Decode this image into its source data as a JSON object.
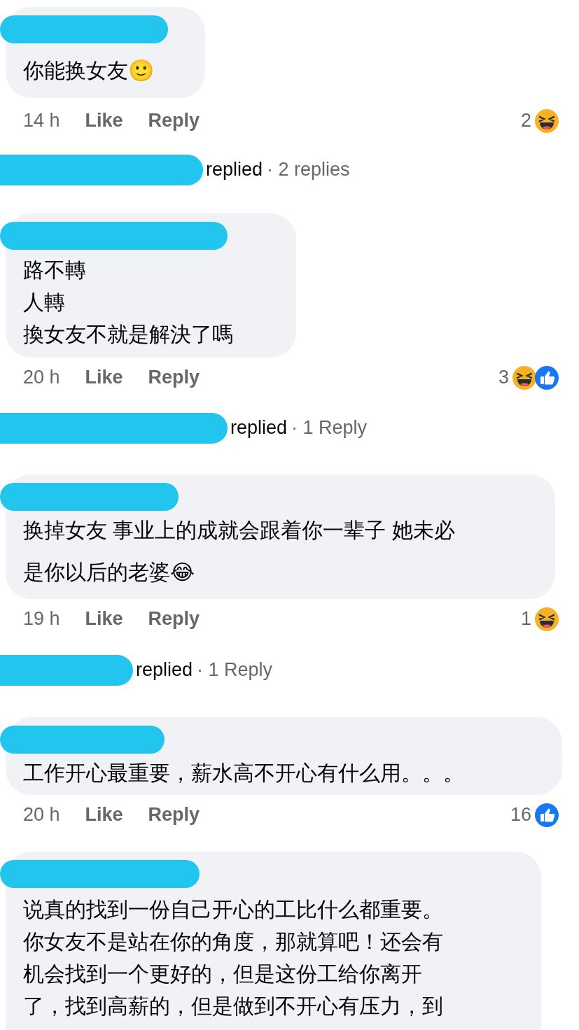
{
  "comments": [
    {
      "lines": [
        "你能换女友🙂"
      ],
      "time": "14 h",
      "actions": [
        "Like",
        "Reply"
      ],
      "reaction_count": "2",
      "reactions": [
        {
          "kind": "haha"
        }
      ],
      "replies": {
        "label": "replied",
        "count": "· 2 replies"
      }
    },
    {
      "lines": [
        "路不轉",
        "人轉",
        "換女友不就是解決了嗎"
      ],
      "time": "20 h",
      "actions": [
        "Like",
        "Reply"
      ],
      "reaction_count": "3",
      "reactions": [
        {
          "kind": "haha"
        },
        {
          "kind": "like"
        }
      ],
      "replies": {
        "label": "replied",
        "count": "· 1 Reply"
      }
    },
    {
      "lines": [
        "换掉女友 事业上的成就会跟着你一辈子 她未必",
        "是你以后的老婆😂"
      ],
      "time": "19 h",
      "actions": [
        "Like",
        "Reply"
      ],
      "reaction_count": "1",
      "reactions": [
        {
          "kind": "haha"
        }
      ],
      "replies": {
        "label": "replied",
        "count": "· 1 Reply"
      }
    },
    {
      "lines": [
        "工作开心最重要，薪水高不开心有什么用。。。"
      ],
      "time": "20 h",
      "actions": [
        "Like",
        "Reply"
      ],
      "reaction_count": "16",
      "reactions": [
        {
          "kind": "like"
        }
      ]
    },
    {
      "lines": [
        "说真的找到一份自己开心的工比什么都重要。",
        "你女友不是站在你的角度，那就算吧！还会有",
        "机会找到一个更好的，但是这份工给你离开",
        "了，找到高薪的，但是做到不开心有压力，到"
      ]
    }
  ]
}
